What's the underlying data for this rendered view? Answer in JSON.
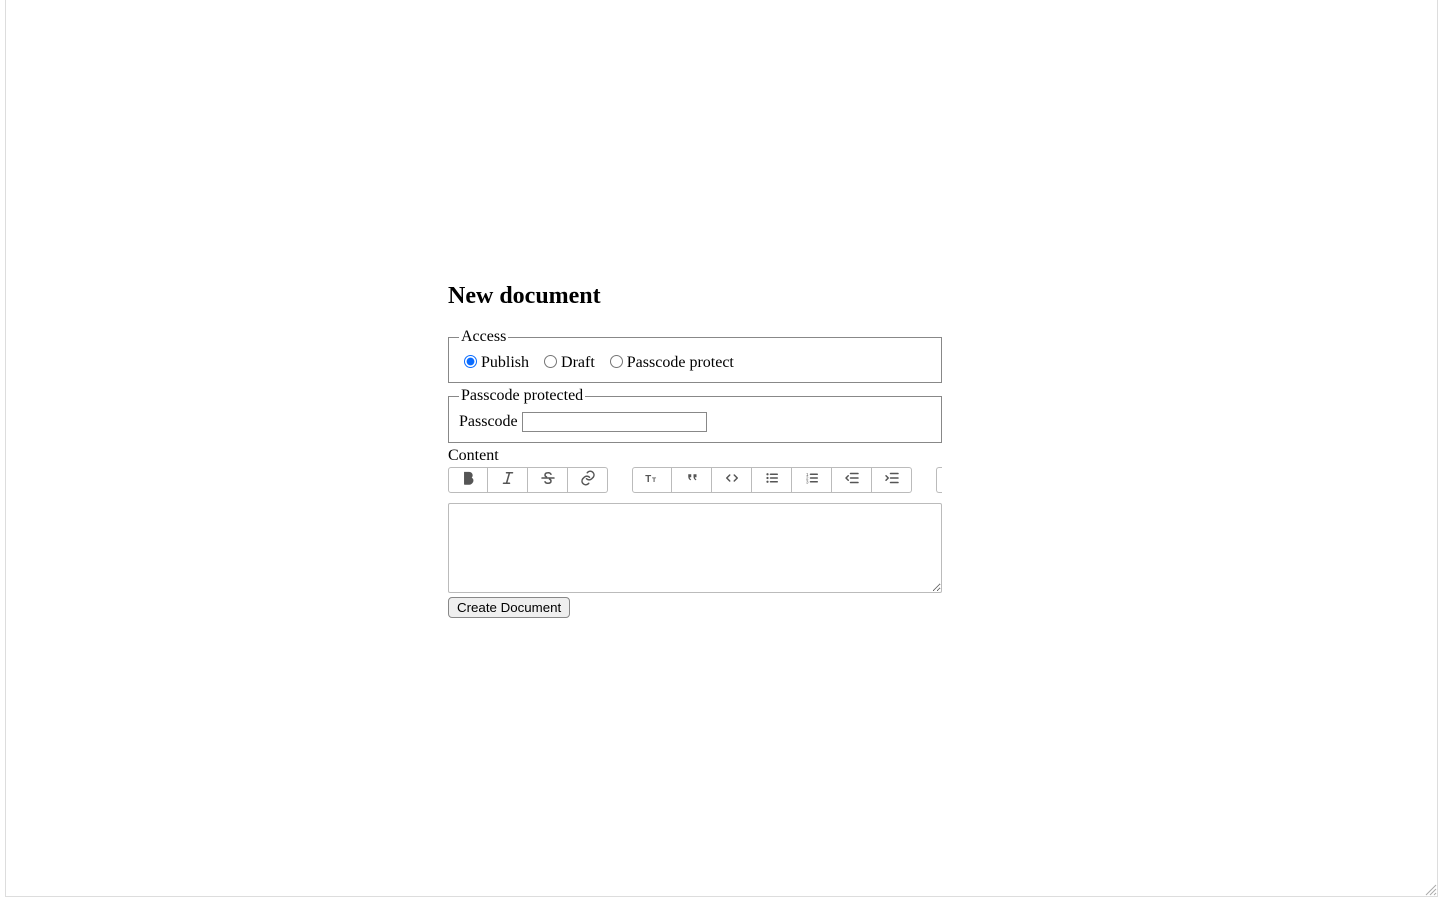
{
  "page": {
    "title": "New document"
  },
  "access": {
    "legend": "Access",
    "options": {
      "publish": "Publish",
      "draft": "Draft",
      "passcode": "Passcode protect"
    },
    "selected": "publish"
  },
  "passcode_section": {
    "legend": "Passcode protected",
    "label": "Passcode",
    "value": ""
  },
  "content": {
    "label": "Content",
    "value": ""
  },
  "toolbar": {
    "bold": "Bold",
    "italic": "Italic",
    "strike": "Strikethrough",
    "link": "Link",
    "heading": "Heading",
    "quote": "Quote",
    "code": "Code",
    "ul": "Bulleted list",
    "ol": "Numbered list",
    "outdent": "Outdent",
    "indent": "Indent"
  },
  "submit": {
    "label": "Create Document"
  }
}
